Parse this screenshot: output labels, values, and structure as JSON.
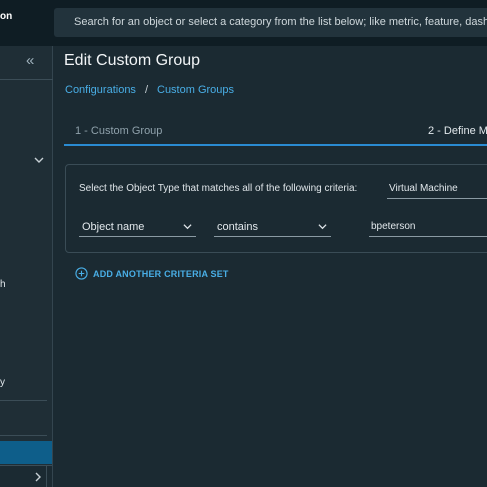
{
  "header": {
    "brand_fragment": "on",
    "search_placeholder": "Search for an object or select a category from the list below; like metric, feature, dash"
  },
  "sidebar": {
    "collapse_glyph": "«",
    "fragments": [
      "h",
      "y"
    ]
  },
  "page": {
    "title": "Edit Custom Group"
  },
  "breadcrumb": {
    "items": [
      "Configurations",
      "Custom Groups"
    ],
    "separator": "/"
  },
  "wizard": {
    "steps": [
      {
        "label": "1 - Custom Group",
        "state": "completed"
      },
      {
        "label": "2 - Define M",
        "state": "current"
      }
    ]
  },
  "criteria": {
    "object_type_label": "Select the Object Type that matches all of the following criteria:",
    "object_type_value": "Virtual Machine",
    "property_value": "Object name",
    "operator_value": "contains",
    "match_value": "bpeterson",
    "add_set_label": "ADD ANOTHER CRITERIA SET"
  },
  "colors": {
    "accent": "#49aee6",
    "active_step_underline": "#2a8bd2",
    "selected_nav": "#0e5e8a",
    "background": "#1b2a32"
  },
  "icons": {
    "collapse": "double-chevron-left-icon",
    "expand": "chevron-down-icon",
    "next": "chevron-right-icon",
    "add": "plus-circle-icon"
  }
}
